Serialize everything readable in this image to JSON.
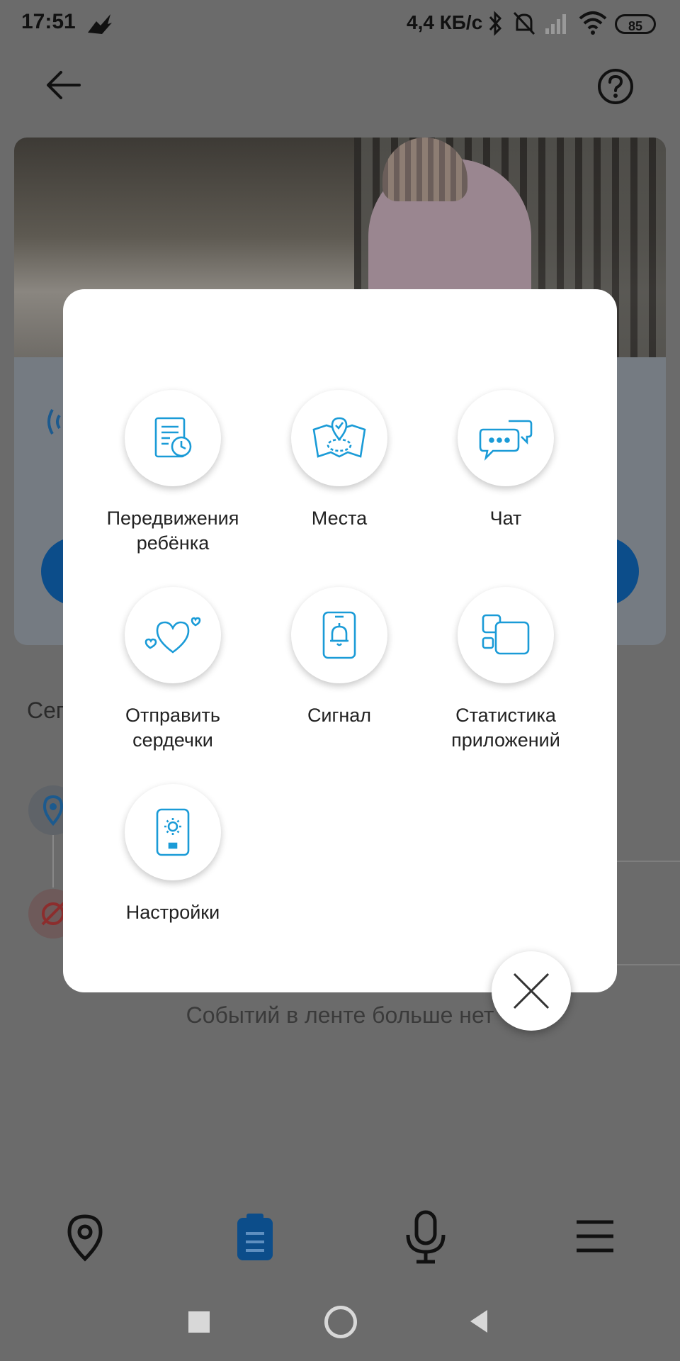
{
  "status_bar": {
    "time": "17:51",
    "speed": "4,4 КБ/с",
    "battery": "85"
  },
  "background": {
    "section_prefix": "Сег",
    "feed_empty": "Событий в ленте больше нет"
  },
  "menu": {
    "items": [
      {
        "label": "Передвижения ребёнка",
        "icon": "movement-history-icon"
      },
      {
        "label": "Места",
        "icon": "places-map-icon"
      },
      {
        "label": "Чат",
        "icon": "chat-icon"
      },
      {
        "label": "Отправить сердечки",
        "icon": "hearts-icon"
      },
      {
        "label": "Сигнал",
        "icon": "signal-bell-icon"
      },
      {
        "label": "Статистика приложений",
        "icon": "app-stats-icon"
      },
      {
        "label": "Настройки",
        "icon": "settings-icon"
      }
    ]
  },
  "colors": {
    "accent": "#1a9bd7",
    "overlay": "#6b6b6b",
    "nav_active": "#0c4d8a"
  }
}
